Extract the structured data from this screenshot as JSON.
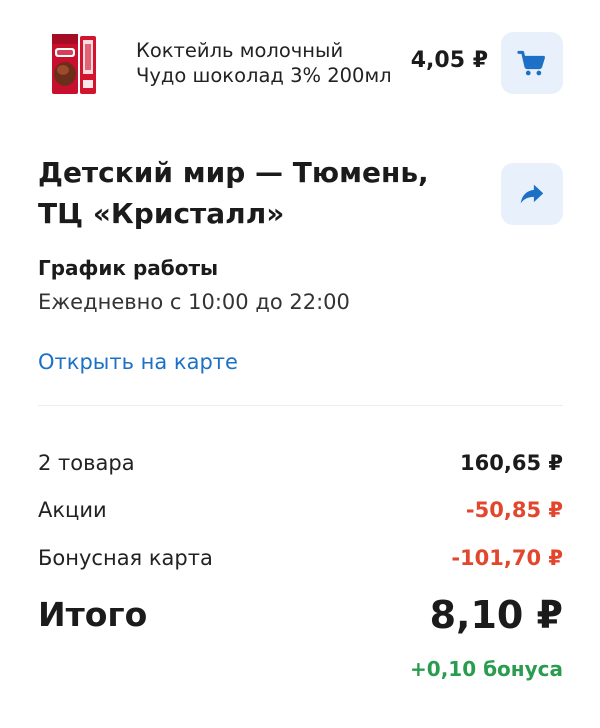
{
  "product": {
    "name_line1": "Коктейль молочный",
    "name_line2": "Чудо шоколад 3% 200мл",
    "price": "4,05 ₽",
    "image_icon": "milk-carton-image",
    "cart_icon": "shopping-cart-icon"
  },
  "store": {
    "name": "Детский мир — Тюмень, ТЦ «Кристалл»",
    "share_icon": "share-arrow-icon",
    "hours_title": "График работы",
    "hours_text": "Ежедневно с 10:00 до 22:00",
    "map_link": "Открыть на карте"
  },
  "summary": {
    "items_label": "2 товара",
    "items_value": "160,65 ₽",
    "promo_label": "Акции",
    "promo_value": "-50,85 ₽",
    "bonus_card_label": "Бонусная карта",
    "bonus_card_value": "-101,70 ₽",
    "total_label": "Итого",
    "total_value": "8,10 ₽",
    "bonus_earned": "+0,10 бонуса"
  },
  "colors": {
    "accent": "#1c71c6",
    "button_bg": "#e8f0fc",
    "discount": "#e2472e",
    "bonus": "#2a9c4f"
  }
}
